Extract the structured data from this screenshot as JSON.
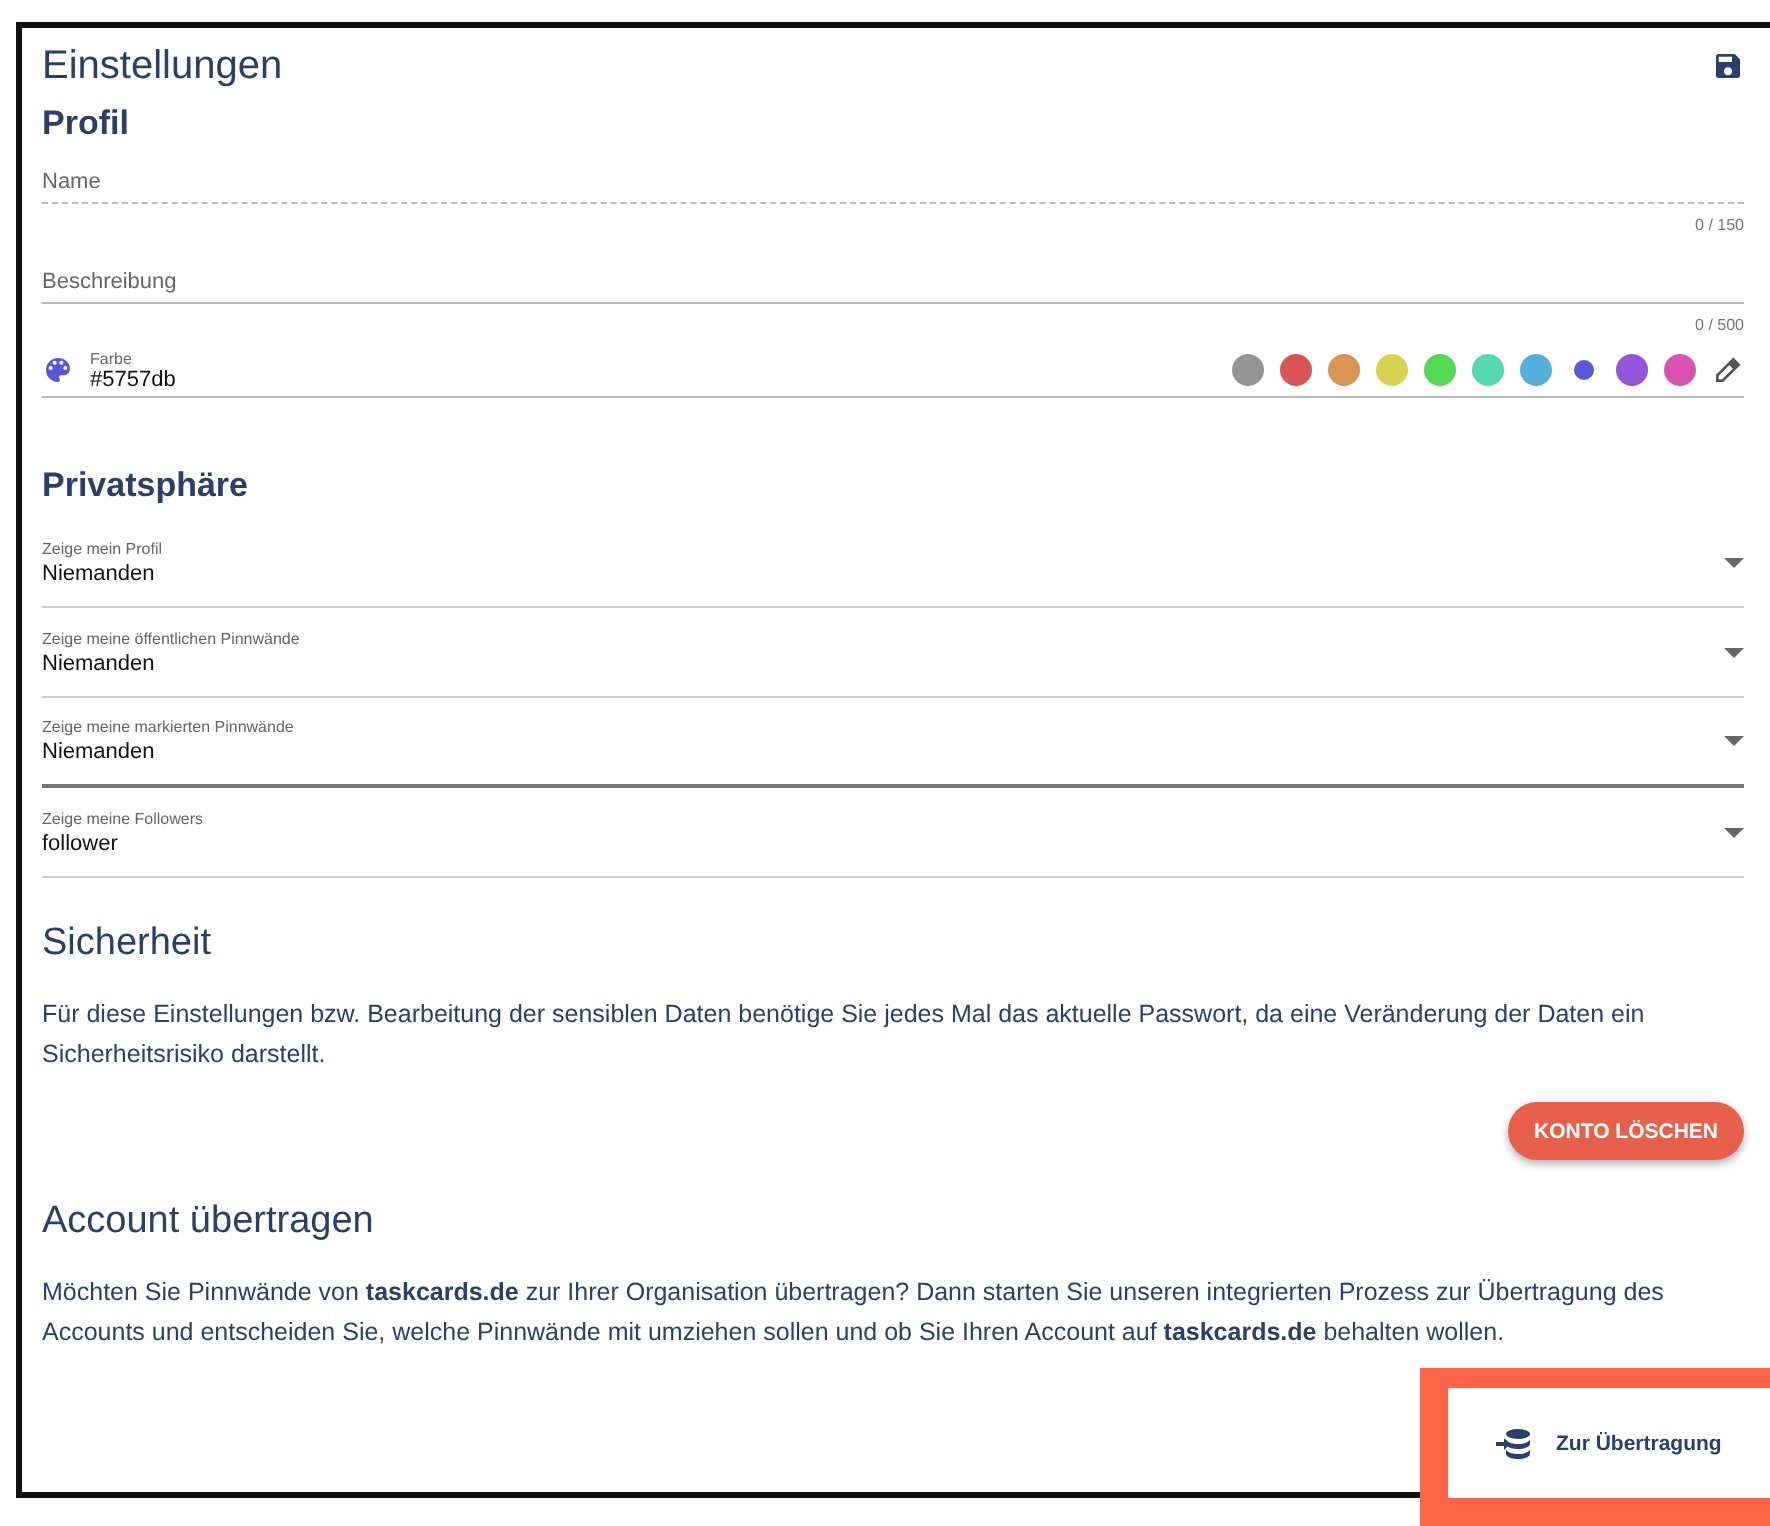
{
  "title": "Einstellungen",
  "profile": {
    "heading": "Profil",
    "fields": [
      {
        "kind": "dashed",
        "placeholder": "Name",
        "counter": "0 / 150"
      },
      {
        "kind": "solid",
        "placeholder": "Beschreibung",
        "counter": "0 / 500"
      }
    ],
    "color": {
      "label": "Farbe",
      "value": "#5757db",
      "swatches": [
        {
          "color": "#959595",
          "selected": false
        },
        {
          "color": "#d95454",
          "selected": false
        },
        {
          "color": "#d99554",
          "selected": false
        },
        {
          "color": "#d9d354",
          "selected": false
        },
        {
          "color": "#54d954",
          "selected": false
        },
        {
          "color": "#54d9b0",
          "selected": false
        },
        {
          "color": "#54b0d9",
          "selected": false
        },
        {
          "color": "#5757db",
          "selected": true
        },
        {
          "color": "#9554d9",
          "selected": false
        },
        {
          "color": "#d954b0",
          "selected": false
        }
      ]
    }
  },
  "privacy": {
    "heading": "Privatsphäre",
    "selects": [
      {
        "label": "Zeige mein Profil",
        "value": "Niemanden",
        "focused": false
      },
      {
        "label": "Zeige meine öffentlichen Pinnwände",
        "value": "Niemanden",
        "focused": false
      },
      {
        "label": "Zeige meine markierten Pinnwände",
        "value": "Niemanden",
        "focused": true
      },
      {
        "label": "Zeige meine Followers",
        "value": "follower",
        "focused": false
      }
    ]
  },
  "security": {
    "heading": "Sicherheit",
    "text": "Für diese Einstellungen bzw. Bearbeitung der sensiblen Daten benötige Sie jedes Mal das aktuelle Passwort, da eine Veränderung der Daten ein Sicherheitsrisiko darstellt.",
    "button": "KONTO LÖSCHEN"
  },
  "transfer": {
    "heading": "Account übertragen",
    "text": "Möchten Sie Pinnwände von **taskcards.de** zur Ihrer Organisation übertragen? Dann starten Sie unseren integrierten Prozess zur Übertragung des Accounts und entscheiden Sie, welche Pinnwände mit umziehen sollen und ob Sie Ihren Account auf **taskcards.de** behalten wollen.",
    "button": "Zur Übertragung"
  }
}
